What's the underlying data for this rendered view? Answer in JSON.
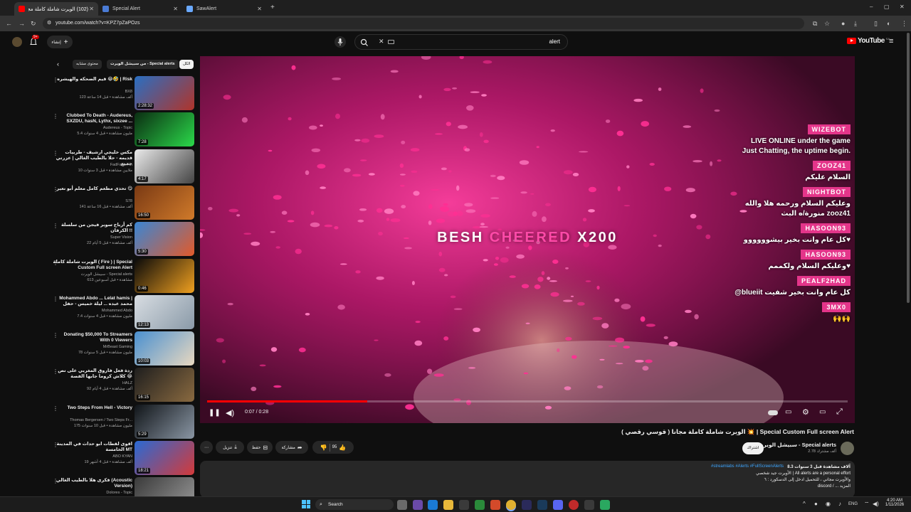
{
  "browser": {
    "tabs": [
      {
        "label": "(102) الويرت شاملة كاملة مجا",
        "active": true,
        "color": "#ff0000"
      },
      {
        "label": "Special Alert",
        "active": false,
        "color": "#4a7bd5"
      },
      {
        "label": "SawAlert",
        "active": false,
        "color": "#6aa9ff"
      }
    ],
    "new_tab": "+",
    "url": "youtube.com/watch?v=KPZ7pZaPOzs",
    "window_controls": [
      "–",
      "▢",
      "✕"
    ]
  },
  "masthead": {
    "logo_text": "YouTube",
    "logo_country": "SA",
    "search_value": "alert",
    "create_label": "إنشاء",
    "notification_count": "9+"
  },
  "related_chips": {
    "first": "الكل",
    "second": "من سبيشل الويرت - Special alerts",
    "third": "محتوى مشابه"
  },
  "related": [
    {
      "title": "قيم الضحكه والهيشره 😂🤣 | Risk",
      "channel": "BX8",
      "meta": "123 ألف مشاهدة • قبل 14 ساعة",
      "duration": "2:28:32",
      "thumb": [
        "#2a6fc2",
        "#b0342a"
      ]
    },
    {
      "title": "Clubbed To Death - Audereus, SXZDU, hasN, Lythx, sixzee ...",
      "channel": "Audereus - Topic",
      "meta": "5.4 مليون مشاهدة • قبل 4 سنوات",
      "duration": "7:28",
      "thumb": [
        "#0b2d12",
        "#2bd94a"
      ]
    },
    {
      "title": "مكس خليجي ارشيف - طربيات قديمه - حلا بالطيب الغالي | عزرتي جميع",
      "channel": "FadFash Fm",
      "meta": "10 ملايين مشاهدة • قبل 3 سنوات",
      "duration": "4:17",
      "thumb": [
        "#eaeaea",
        "#444444"
      ]
    },
    {
      "title": "تحدي مطعم كامل معلم أبو نعير 😋",
      "channel": "S78",
      "meta": "141 ألف مشاهدة • قبل 16 ساعة",
      "duration": "16:50",
      "thumb": [
        "#7a3a14",
        "#d07a2a"
      ]
    },
    {
      "title": "كم أرباح سوبر فيجن من سلسلة الكرفان !!",
      "channel": "Super Vision",
      "meta": "22 ألف مشاهدة • قبل 5 أيام",
      "duration": "5:30",
      "thumb": [
        "#3a86d4",
        "#e25a2a"
      ]
    },
    {
      "title": "الويرت شاملة كاملة ( Fire ) | Special Custom Full screen Alert",
      "channel": "سبيشل الويرت - Special alerts",
      "meta": "613 مشاهدة • قبل أسبوعين",
      "duration": "0:46",
      "thumb": [
        "#0a0a0a",
        "#f0a020"
      ]
    },
    {
      "title": "Mohammed Abdo ... Lelat hamis | محمد عبده ... ليلة خميس - حفل",
      "channel": "Mohammed Abdo",
      "meta": "7.4 مليون مشاهدة • قبل 4 سنوات",
      "duration": "12:13",
      "thumb": [
        "#d8dde2",
        "#8a9aa8"
      ]
    },
    {
      "title": "Donating $50,000 To Streamers With 0 Viewers",
      "channel": "MrBeast Gaming",
      "meta": "78 مليون مشاهدة • قبل 5 سنوات",
      "duration": "10:03",
      "thumb": [
        "#4a90d0",
        "#e8d8c0"
      ]
    },
    {
      "title": "ردة فعل فاروق المغربي على نص كلاش كروما جابها الفصة 😂",
      "channel": "HALZ",
      "meta": "92 ألف مشاهدة • قبل 4 أيام",
      "duration": "16:15",
      "thumb": [
        "#1e1e1e",
        "#8a6a40"
      ]
    },
    {
      "title": "Two Steps From Hell - Victory",
      "channel": "Thomas Bergersen / Two Steps Fr...",
      "meta": "175 مليون مشاهدة • قبل 10 سنوات",
      "duration": "5:29",
      "thumb": [
        "#101418",
        "#8a96a4"
      ]
    },
    {
      "title": "اقوى لقطات ابو حداث في المدينة الخامسة MT",
      "channel": "ABO KYAN",
      "meta": "19 ألف مشاهدة • قبل 4 أشهر",
      "duration": "18:21",
      "thumb": [
        "#2a6ad4",
        "#d43a3a"
      ]
    },
    {
      "title": "فكرى هلا بالطيب الغالي (Acoustic Version)",
      "channel": "Dolores - Topic",
      "meta": "",
      "duration": "",
      "thumb": [
        "#3a3a3a",
        "#9a9a9a"
      ]
    }
  ],
  "player": {
    "cheer_user": "BESH",
    "cheer_word": "CHEERED",
    "cheer_amount": "X200",
    "time": "0:07 / 0:28",
    "progress": 0.25,
    "chat": [
      {
        "name": "WIZEBOT",
        "msg": "LIVE ONLINE under the game"
      },
      {
        "name": "",
        "msg": "Just Chatting, the uptime begin."
      },
      {
        "name": "ZOOZ41",
        "msg": "السلام عليكم"
      },
      {
        "name": "NIGHTBOT",
        "msg": "وعليكم السلام ورحمه هلا والله"
      },
      {
        "name": "",
        "msg": "منورة/ه البث zooz41"
      },
      {
        "name": "HASOON93",
        "msg": "كل عام وانت بخير بيشوووووو♥"
      },
      {
        "name": "HASOON93",
        "msg": "وعليكم السلام ولكممم♥"
      },
      {
        "name": "PEALF2HAD",
        "msg": "@blueiit كل عام وانت بخير شفيت"
      },
      {
        "name": "3MX0",
        "msg": "🙌🙌"
      }
    ]
  },
  "video": {
    "title": "الويرت شاملة كاملة مجانا ( قوسي رقصي ) 💥 | Special Custom Full screen Alert",
    "channel": "سبيشل الويرت - Special alerts",
    "subscribers": "2.78 ألف مشترك",
    "subscribe_label": "اشتراك",
    "likes": "95",
    "share_label": "مشاركة",
    "save_label": "حفظ",
    "download_label": "تنزيل",
    "desc_meta": "8.3 آلاف مشاهدة  قبل 3 سنوات",
    "desc_tags": "#streamlabs #Alerts #FullScreenAlerts",
    "desc_line1": "الأويرت جيد شخصي | All alerts are a personal effort",
    "desc_line2": "والأويرت مجاني ، للتحميل ادخل إلى الدسكورد : ٦",
    "desc_line3": "discord / ... المزيد"
  },
  "taskbar": {
    "search_label": "Search",
    "lang": "ENG",
    "time": "4:20 AM",
    "date": "1/11/2026"
  }
}
